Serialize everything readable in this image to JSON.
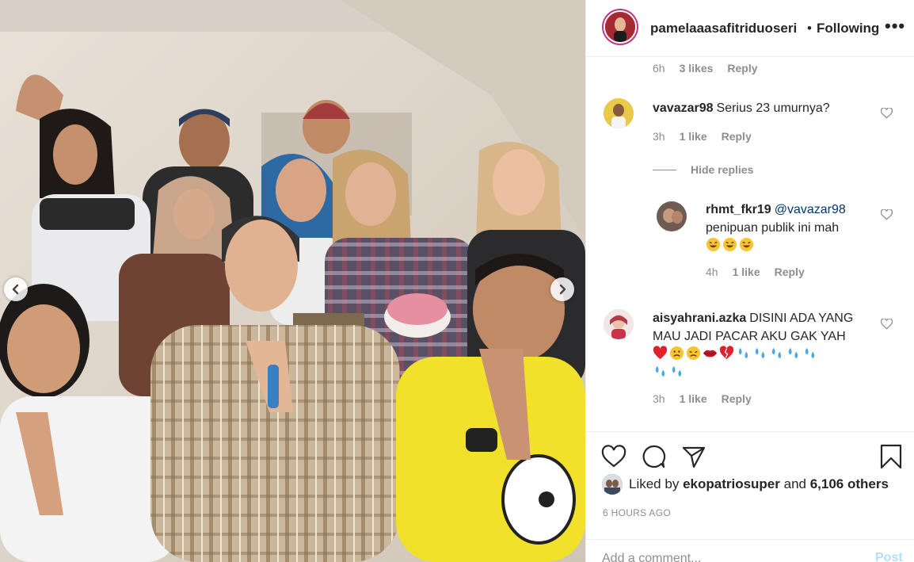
{
  "post": {
    "author": "pamelaaasafitriduoseri",
    "separator": "•",
    "follow_status": "Following",
    "more_icon": "more-options-icon"
  },
  "comments": [
    {
      "id": "top-reply-meta",
      "time": "6h",
      "likes": "3 likes",
      "reply": "Reply"
    },
    {
      "id": "c1",
      "username": "vavazar98",
      "text": "Serius 23 umurnya?",
      "time": "3h",
      "likes": "1 like",
      "reply": "Reply"
    },
    {
      "id": "c1-reply",
      "username": "rhmt_fkr19",
      "mention": "@vavazar98",
      "text": "penipuan publik ini mah",
      "emojis": [
        "rolling-laughing-emoji",
        "rolling-laughing-emoji",
        "rolling-laughing-emoji"
      ],
      "time": "4h",
      "likes": "1 like",
      "reply": "Reply"
    },
    {
      "id": "c2",
      "username": "aisyahrani.azka",
      "text": "DISINI ADA YANG MAU JADI PACAR AKU GAK YAH",
      "emojis": [
        "red-heart-emoji",
        "frowning-face-emoji",
        "disappointed-face-emoji",
        "kiss-lips-emoji",
        "broken-heart-emoji",
        "sweat-droplets-emoji",
        "sweat-droplets-emoji",
        "sweat-droplets-emoji",
        "sweat-droplets-emoji",
        "sweat-droplets-emoji",
        "sweat-droplets-emoji",
        "sweat-droplets-emoji"
      ],
      "time": "3h",
      "likes": "1 like",
      "reply": "Reply"
    }
  ],
  "hide_replies": "Hide replies",
  "likes": {
    "prefix": "Liked by",
    "top_liker": "ekopatriosuper",
    "conjunction": "and",
    "others": "6,106 others"
  },
  "timestamp": "6 HOURS AGO",
  "add_comment": {
    "placeholder": "Add a comment...",
    "post_label": "Post"
  },
  "colors": {
    "border": "#efefef",
    "muted": "#8e8e8e",
    "text": "#262626",
    "post_disabled": "#b2dffc",
    "story_ring": "#c13584"
  }
}
